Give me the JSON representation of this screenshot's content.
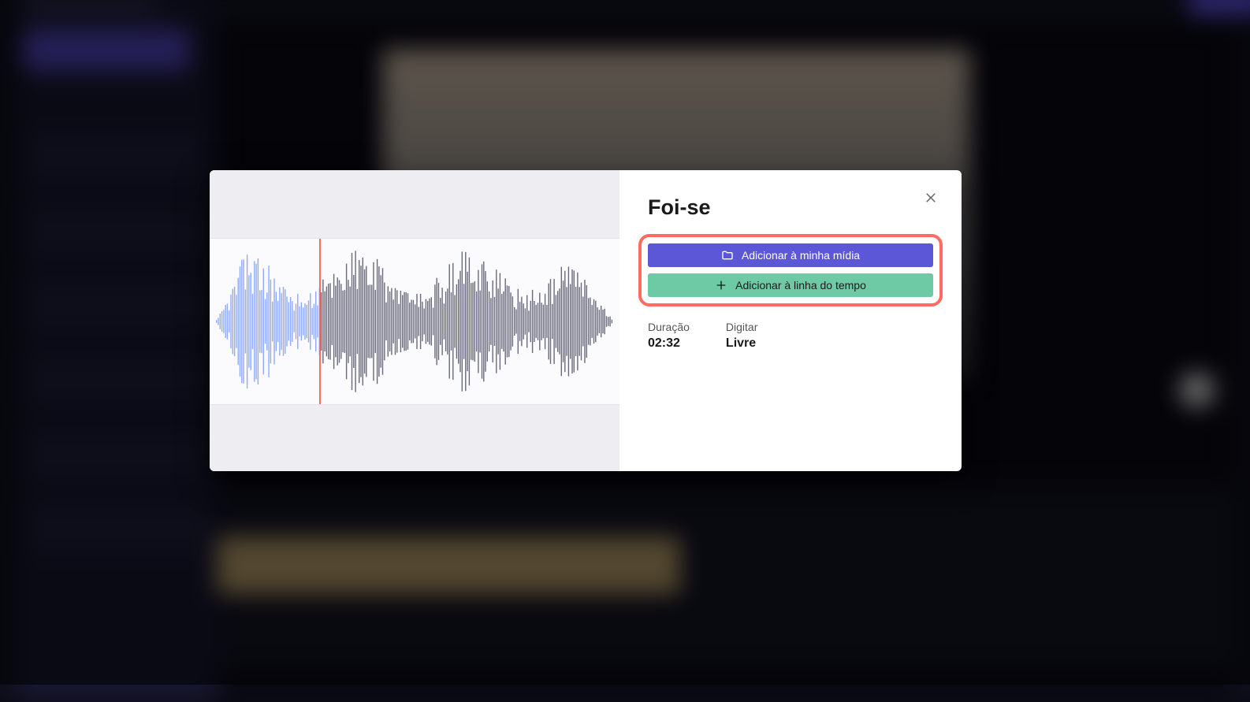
{
  "modal": {
    "title": "Foi-se",
    "add_media_label": "Adicionar à minha mídia",
    "add_timeline_label": "Adicionar à linha do tempo",
    "meta": {
      "duration_label": "Duração",
      "duration_value": "02:32",
      "type_label": "Digitar",
      "type_value": "Livre"
    },
    "waveform": {
      "playhead_fraction": 0.26,
      "played_color": "#8aa4ff",
      "remaining_color": "#5a5a6e"
    }
  }
}
